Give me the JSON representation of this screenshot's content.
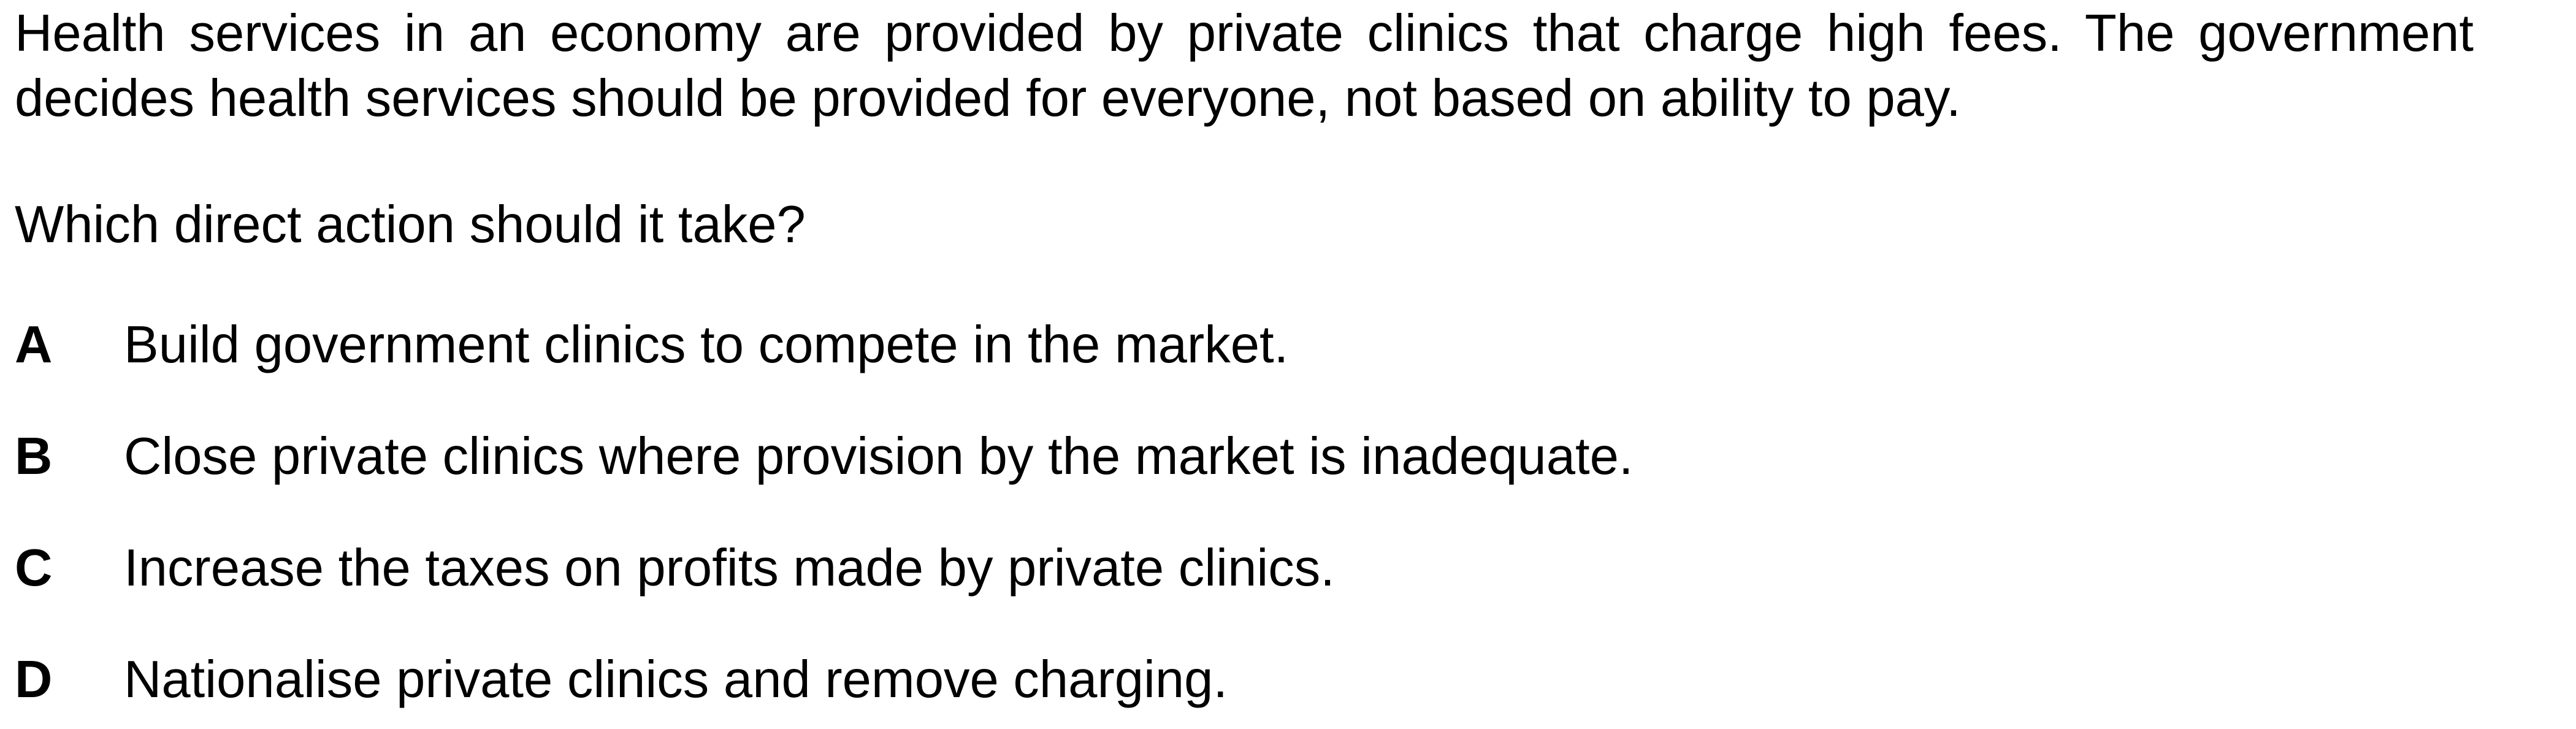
{
  "question": {
    "stem": "Health services in an economy are provided by private clinics that charge high fees. The government decides health services should be provided for everyone, not based on ability to pay.",
    "prompt": "Which direct action should it take?",
    "options": [
      {
        "letter": "A",
        "text": "Build government clinics to compete in the market."
      },
      {
        "letter": "B",
        "text": "Close private clinics where provision by the market is inadequate."
      },
      {
        "letter": "C",
        "text": "Increase the taxes on profits made by private clinics."
      },
      {
        "letter": "D",
        "text": "Nationalise private clinics and remove charging."
      }
    ]
  }
}
